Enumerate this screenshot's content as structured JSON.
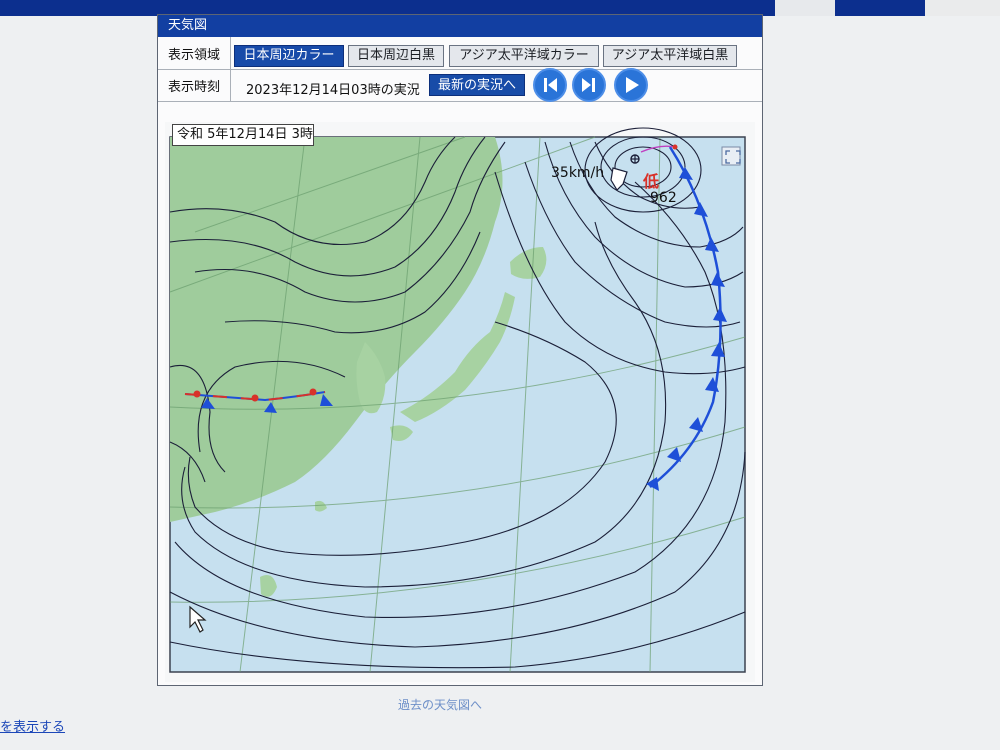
{
  "panel": {
    "title": "天気図",
    "area_label": "表示領域",
    "area_buttons": [
      "日本周辺カラー",
      "日本周辺白黒",
      "アジア太平洋域カラー",
      "アジア太平洋域白黒"
    ],
    "time_label": "表示時刻",
    "time_text": "2023年12月14日03時の実況",
    "latest_button": "最新の実況へ"
  },
  "map": {
    "date_label": "令和 5年12月14日 3時",
    "low_kanji": "低",
    "low_pressure": "962",
    "speed": "35km/h"
  },
  "footer": {
    "past_link": "過去の天気図へ",
    "left_link": "を表示する"
  },
  "colors": {
    "header_blue": "#123fa2",
    "land_green": "#9fcc9c",
    "sea_blue": "#c6e0ef",
    "cold_front": "#1e4fd8",
    "warm_front": "#d8322a"
  }
}
